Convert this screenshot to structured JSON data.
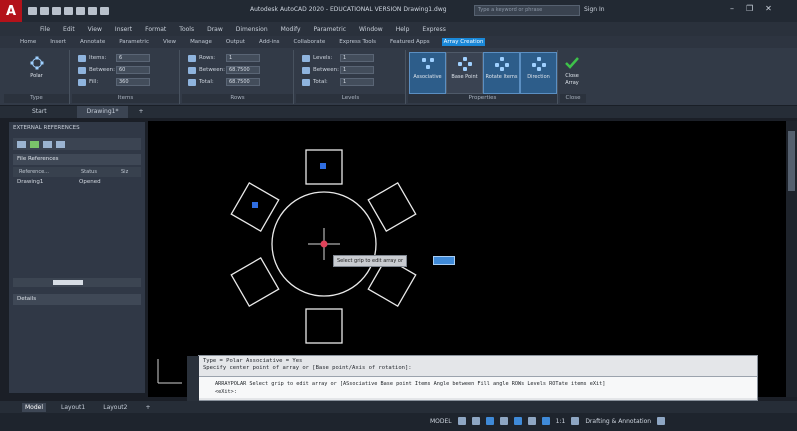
{
  "app": {
    "logo": "A",
    "title": "Autodesk AutoCAD 2020 - EDUCATIONAL VERSION   Drawing1.dwg",
    "search_placeholder": "Type a keyword or phrase",
    "sign_in": "Sign In"
  },
  "menu": [
    "File",
    "Edit",
    "View",
    "Insert",
    "Format",
    "Tools",
    "Draw",
    "Dimension",
    "Modify",
    "Parametric",
    "Window",
    "Help",
    "Express"
  ],
  "ribbon_tabs": [
    "Home",
    "Insert",
    "Annotate",
    "Parametric",
    "View",
    "Manage",
    "Output",
    "Add-ins",
    "Collaborate",
    "Express Tools",
    "Featured Apps",
    "Array Creation"
  ],
  "active_ribbon_tab": "Array Creation",
  "ribbon": {
    "type": {
      "button": "Polar",
      "title": "Type"
    },
    "items": {
      "title": "Items",
      "rows": [
        {
          "label": "Items:",
          "value": "6"
        },
        {
          "label": "Between:",
          "value": "60"
        },
        {
          "label": "Fill:",
          "value": "360"
        }
      ]
    },
    "rows": {
      "title": "Rows",
      "rows": [
        {
          "label": "Rows:",
          "value": "1"
        },
        {
          "label": "Between:",
          "value": "68.7500"
        },
        {
          "label": "Total:",
          "value": "68.7500"
        }
      ]
    },
    "levels": {
      "title": "Levels",
      "rows": [
        {
          "label": "Levels:",
          "value": "1"
        },
        {
          "label": "Between:",
          "value": "1"
        },
        {
          "label": "Total:",
          "value": "1"
        }
      ]
    },
    "properties": {
      "title": "Properties",
      "buttons": [
        "Associative",
        "Base Point",
        "Rotate Items",
        "Direction"
      ]
    },
    "close": {
      "label": "Close Array",
      "title": "Close"
    }
  },
  "file_tabs": [
    "Start",
    "Drawing1*"
  ],
  "palette": {
    "title": "EXTERNAL REFERENCES",
    "file_refs_header": "File References",
    "columns": [
      "Reference...",
      "Status",
      "Siz"
    ],
    "row": {
      "name": "Drawing1",
      "status": "Opened"
    },
    "details_header": "Details"
  },
  "canvas": {
    "tooltip": "Select grip to edit array or"
  },
  "command": {
    "history_line1": "Type = Polar  Associative = Yes",
    "history_line2": "Specify center point of array or [Base point/Axis of rotation]:",
    "prompt": "ARRAYPOLAR Select grip to edit array or [ASsociative Base point Items Angle between Fill angle ROWs Levels ROTate items eXit]",
    "prompt2": "<eXit>:"
  },
  "layout_tabs": [
    "Model",
    "Layout1",
    "Layout2"
  ],
  "status": {
    "model": "MODEL",
    "scale": "1:1",
    "workspace": "Drafting & Annotation"
  }
}
